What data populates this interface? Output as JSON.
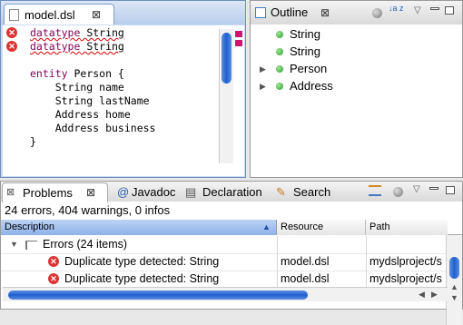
{
  "editor": {
    "tab_label": "model.dsl",
    "close_glyph": "⊠",
    "error_marker_glyph": "✕",
    "lines": [
      {
        "keyword": "datatype",
        "rest": " String",
        "error": true
      },
      {
        "keyword": "datatype",
        "rest": " String",
        "error": true
      },
      {
        "keyword": "",
        "rest": "",
        "error": false
      },
      {
        "keyword": "entity",
        "rest": " Person {",
        "error": false
      },
      {
        "keyword": "",
        "rest": "    String name",
        "error": false
      },
      {
        "keyword": "",
        "rest": "    String lastName",
        "error": false
      },
      {
        "keyword": "",
        "rest": "    Address home",
        "error": false
      },
      {
        "keyword": "",
        "rest": "    Address business",
        "error": false
      },
      {
        "keyword": "",
        "rest": "}",
        "error": false
      }
    ],
    "keyword_color": "#7f0055",
    "error_color": "#d33333"
  },
  "outline": {
    "tab_label": "Outline",
    "close_glyph": "⊠",
    "toolbar_icons": [
      "filter-icon",
      "sort-az-icon",
      "view-menu-icon",
      "minimize-icon",
      "maximize-icon"
    ],
    "sort_glyph": "↓a z",
    "items": [
      {
        "label": "String",
        "expandable": false
      },
      {
        "label": "String",
        "expandable": false
      },
      {
        "label": "Person",
        "expandable": true
      },
      {
        "label": "Address",
        "expandable": true
      }
    ]
  },
  "problems": {
    "tabs": [
      {
        "label": "Problems",
        "icon": "problems-icon",
        "glyph": "⊠",
        "active": true
      },
      {
        "label": "Javadoc",
        "icon": "javadoc-icon",
        "glyph": "@",
        "active": false
      },
      {
        "label": "Declaration",
        "icon": "declaration-icon",
        "glyph": "▤",
        "active": false
      },
      {
        "label": "Search",
        "icon": "search-icon",
        "glyph": "✎",
        "active": false
      }
    ],
    "tab_close_glyph": "⊠",
    "summary": "24 errors, 404 warnings, 0 infos",
    "columns": [
      "Description",
      "Resource",
      "Path"
    ],
    "group": {
      "label": "Errors (24 items)",
      "expanded": true
    },
    "rows": [
      {
        "description": "Duplicate type detected: String",
        "resource": "model.dsl",
        "path": "mydslproject/s"
      },
      {
        "description": "Duplicate type detected: String",
        "resource": "model.dsl",
        "path": "mydslproject/s"
      }
    ]
  }
}
